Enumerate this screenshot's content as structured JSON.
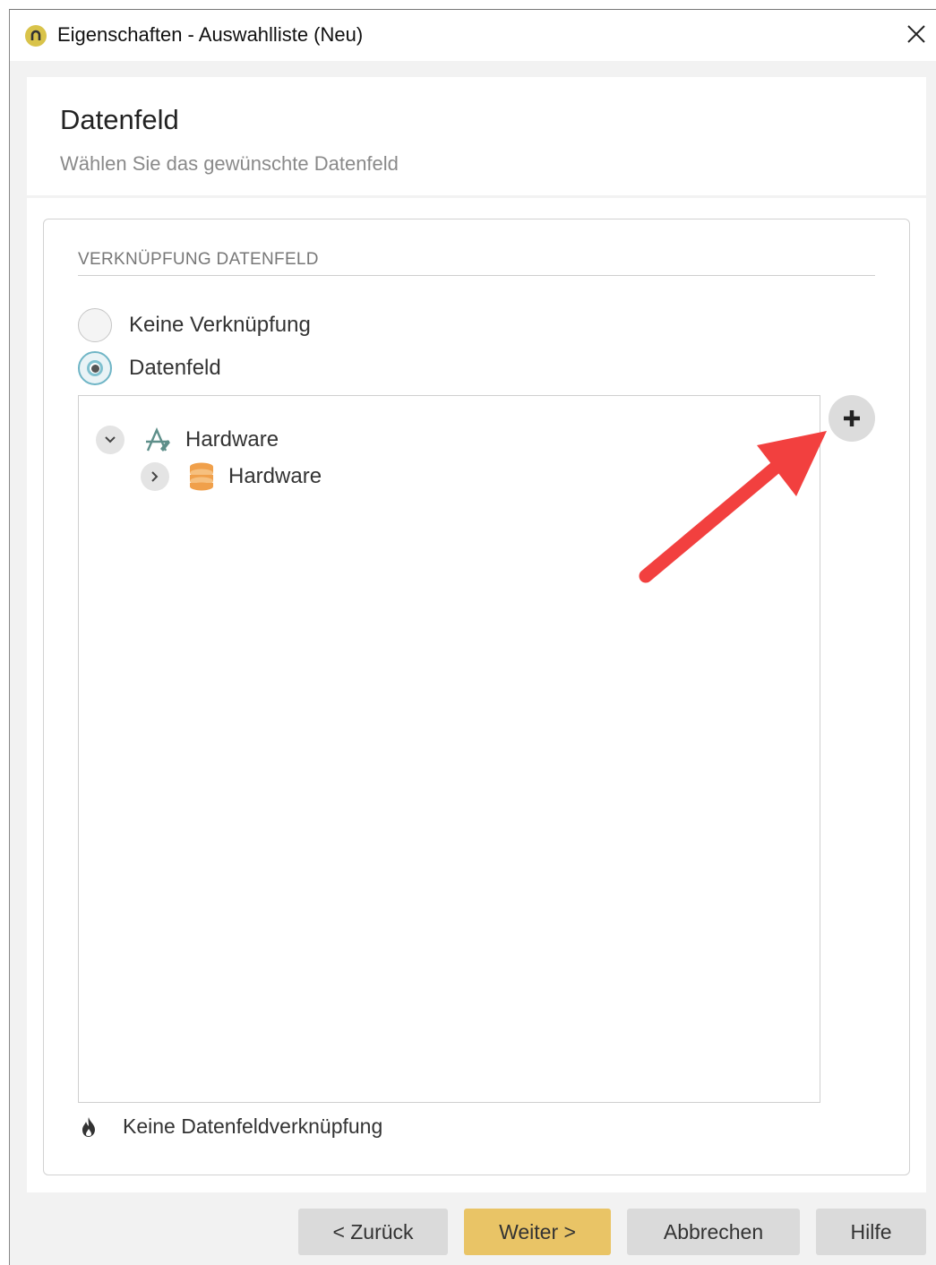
{
  "window": {
    "title": "Eigenschaften - Auswahlliste (Neu)",
    "app_icon": "app-logo-icon",
    "close_icon": "close-icon"
  },
  "header": {
    "title": "Datenfeld",
    "subtitle": "Wählen Sie das gewünschte Datenfeld"
  },
  "section": {
    "label": "VERKNÜPFUNG DATENFELD"
  },
  "options": {
    "none_label": "Keine Verknüpfung",
    "datafield_label": "Datenfeld",
    "selected": "Datenfeld"
  },
  "tree": {
    "root": {
      "label": "Hardware",
      "icon": "app-designer-icon",
      "expanded": true
    },
    "child": {
      "label": "Hardware",
      "icon": "database-icon",
      "expanded": false
    }
  },
  "status": {
    "text": "Keine Datenfeldverknüpfung",
    "icon": "flame-icon"
  },
  "buttons": {
    "back": "< Zurück",
    "next": "Weiter >",
    "cancel": "Abbrechen",
    "help": "Hilfe"
  },
  "colors": {
    "primary_button": "#e9c466",
    "annotation_arrow": "#f2403f",
    "radio_accent": "#6fb5c6",
    "database_icon": "#f0a04b"
  }
}
